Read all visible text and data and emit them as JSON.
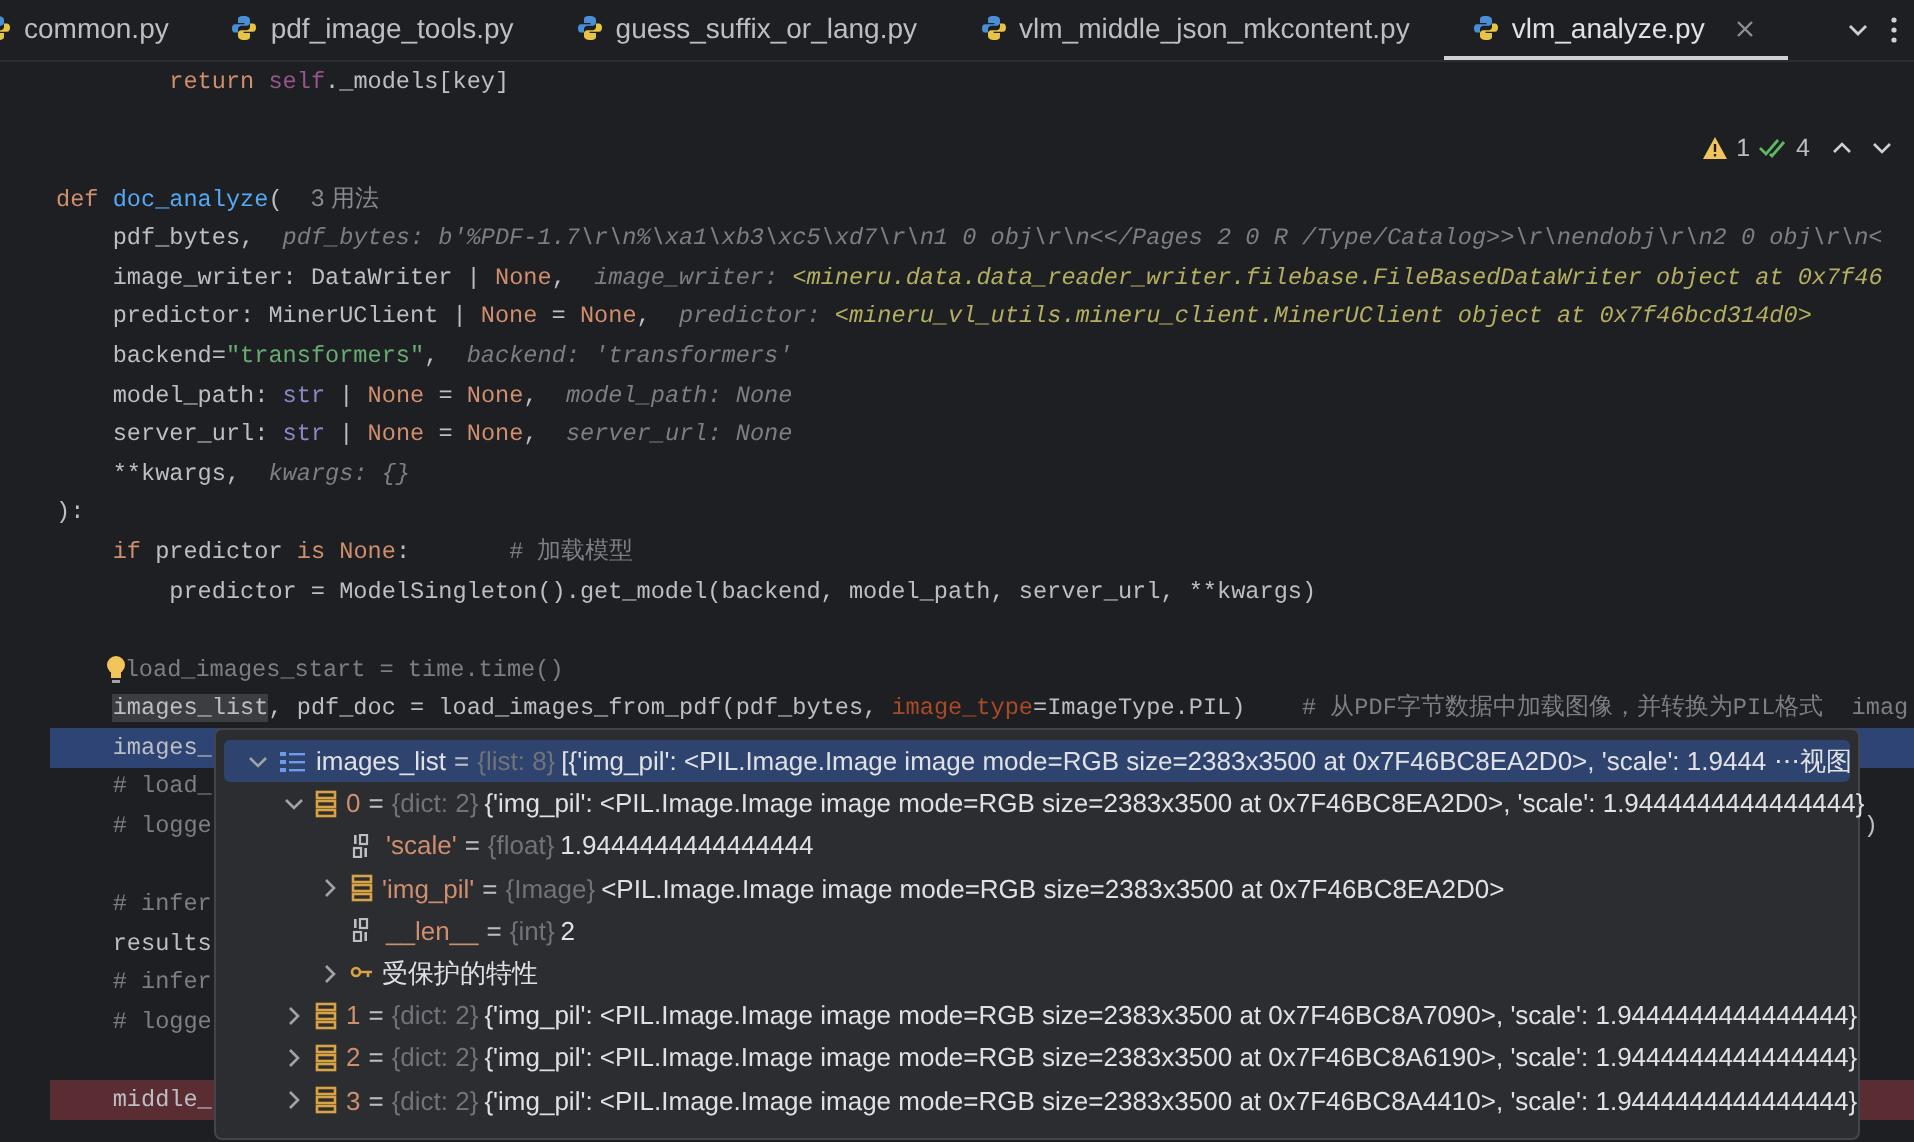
{
  "tabs": [
    {
      "label": "common.py",
      "selected": false
    },
    {
      "label": "pdf_image_tools.py",
      "selected": false
    },
    {
      "label": "guess_suffix_or_lang.py",
      "selected": false
    },
    {
      "label": "vlm_middle_json_mkcontent.py",
      "selected": false
    },
    {
      "label": "vlm_analyze.py",
      "selected": true
    }
  ],
  "inspections": {
    "warnings": "1",
    "passed": "4"
  },
  "lines": [
    {
      "tokens": [
        {
          "t": "        return ",
          "kind": "kw"
        },
        {
          "t": "self",
          "kind": "self"
        },
        {
          "t": "._models[key]",
          "kind": "plain"
        }
      ]
    },
    {
      "kind": "blank"
    },
    {
      "kind": "blank"
    },
    {
      "tokens": [
        {
          "t": "def ",
          "kind": "kw"
        },
        {
          "t": "doc_analyze",
          "kind": "fn"
        },
        {
          "t": "(  ",
          "kind": "plain"
        },
        {
          "t": "3 用法",
          "kind": "usage"
        }
      ]
    },
    {
      "tokens": [
        {
          "t": "    pdf_bytes,  ",
          "kind": "plain"
        },
        {
          "t": "pdf_bytes: b'%PDF-1.7\\r\\n%\\xa1\\xb3\\xc5\\xd7\\r\\n1 0 obj\\r\\n<</Pages 2 0 R /Type/Catalog>>\\r\\nendobj\\r\\n2 0 obj\\r\\n<",
          "kind": "hint"
        }
      ]
    },
    {
      "tokens": [
        {
          "t": "    image_writer: DataWriter | ",
          "kind": "plain"
        },
        {
          "t": "None",
          "kind": "kw"
        },
        {
          "t": ",  ",
          "kind": "plain"
        },
        {
          "t": "image_writer: ",
          "kind": "hint"
        },
        {
          "t": "<mineru.data.data_reader_writer.filebase.FileBasedDataWriter object at 0x7f46",
          "kind": "hintval"
        }
      ]
    },
    {
      "tokens": [
        {
          "t": "    predictor: MinerUClient | ",
          "kind": "plain"
        },
        {
          "t": "None",
          "kind": "kw"
        },
        {
          "t": " = ",
          "kind": "plain"
        },
        {
          "t": "None",
          "kind": "kw"
        },
        {
          "t": ",  ",
          "kind": "plain"
        },
        {
          "t": "predictor: ",
          "kind": "hint"
        },
        {
          "t": "<mineru_vl_utils.mineru_client.MinerUClient object at 0x7f46bcd314d0>",
          "kind": "hintval"
        }
      ]
    },
    {
      "tokens": [
        {
          "t": "    backend=",
          "kind": "plain"
        },
        {
          "t": "\"transformers\"",
          "kind": "str"
        },
        {
          "t": ",  ",
          "kind": "plain"
        },
        {
          "t": "backend: 'transformers'",
          "kind": "hint"
        }
      ]
    },
    {
      "tokens": [
        {
          "t": "    model_path: ",
          "kind": "plain"
        },
        {
          "t": "str",
          "kind": "builtin"
        },
        {
          "t": " | ",
          "kind": "plain"
        },
        {
          "t": "None",
          "kind": "kw"
        },
        {
          "t": " = ",
          "kind": "plain"
        },
        {
          "t": "None",
          "kind": "kw"
        },
        {
          "t": ",  ",
          "kind": "plain"
        },
        {
          "t": "model_path: None",
          "kind": "hint"
        }
      ]
    },
    {
      "tokens": [
        {
          "t": "    server_url: ",
          "kind": "plain"
        },
        {
          "t": "str",
          "kind": "builtin"
        },
        {
          "t": " | ",
          "kind": "plain"
        },
        {
          "t": "None",
          "kind": "kw"
        },
        {
          "t": " = ",
          "kind": "plain"
        },
        {
          "t": "None",
          "kind": "kw"
        },
        {
          "t": ",  ",
          "kind": "plain"
        },
        {
          "t": "server_url: None",
          "kind": "hint"
        }
      ]
    },
    {
      "tokens": [
        {
          "t": "    **kwargs,  ",
          "kind": "plain"
        },
        {
          "t": "kwargs: {}",
          "kind": "hint"
        }
      ]
    },
    {
      "tokens": [
        {
          "t": "):",
          "kind": "plain"
        }
      ]
    },
    {
      "tokens": [
        {
          "t": "    if ",
          "kind": "kw"
        },
        {
          "t": "predictor ",
          "kind": "plain"
        },
        {
          "t": "is None",
          "kind": "kw"
        },
        {
          "t": ":       ",
          "kind": "plain"
        },
        {
          "t": "# 加载模型",
          "kind": "comment"
        }
      ]
    },
    {
      "tokens": [
        {
          "t": "        predictor = ModelSingleton().get_model(backend, model_path, server_url, **kwargs)",
          "kind": "plain"
        }
      ]
    },
    {
      "kind": "blank"
    },
    {
      "bulb": true,
      "tokens": [
        {
          "t": "    load_images_start = time.time()",
          "kind": "comment"
        }
      ]
    },
    {
      "tokens": [
        {
          "t": "    images_list",
          "kind": "hl"
        },
        {
          "t": ", pdf_doc = load_images_from_pdf(pdf_bytes, ",
          "kind": "plain"
        },
        {
          "t": "image_type",
          "kind": "param"
        },
        {
          "t": "=ImageType.PIL)    ",
          "kind": "plain"
        },
        {
          "t": "# 从PDF字节数据中加载图像，并转换为PIL格式  imag",
          "kind": "comment"
        }
      ]
    },
    {
      "kind": "current",
      "tokens": [
        {
          "t": "    images_",
          "kind": "plain"
        }
      ]
    },
    {
      "tokens": [
        {
          "t": "    # load_",
          "kind": "comment"
        }
      ]
    },
    {
      "tokens": [
        {
          "t": "    # logge",
          "kind": "comment"
        }
      ],
      "tail": ")"
    },
    {
      "kind": "blank"
    },
    {
      "tokens": [
        {
          "t": "    # infer",
          "kind": "comment"
        }
      ]
    },
    {
      "tokens": [
        {
          "t": "    results",
          "kind": "plain"
        }
      ]
    },
    {
      "tokens": [
        {
          "t": "    # infer",
          "kind": "comment"
        }
      ]
    },
    {
      "tokens": [
        {
          "t": "    # logge",
          "kind": "comment"
        }
      ]
    },
    {
      "kind": "blank"
    },
    {
      "kind": "breakpoint",
      "tokens": [
        {
          "t": "    middle_",
          "kind": "plain"
        }
      ]
    }
  ],
  "debug_popup": {
    "view_link": "视图",
    "node": {
      "kind": "list",
      "name": "images_list",
      "eq": "=",
      "type": "{list: 8}",
      "value": "[{'img_pil': <PIL.Image.Image image mode=RGB size=2383x3500 at 0x7F46BC8EA2D0>, 'scale': 1.9444 ⋯",
      "expanded": true,
      "selected": true,
      "children": [
        {
          "kind": "dict",
          "name": "0",
          "eq": "=",
          "type": "{dict: 2}",
          "value": "{'img_pil': <PIL.Image.Image image mode=RGB size=2383x3500 at 0x7F46BC8EA2D0>, 'scale': 1.9444444444444444}",
          "expanded": true,
          "selected": false,
          "children": [
            {
              "kind": "number",
              "name": "'scale'",
              "eq": "=",
              "type": "{float}",
              "value": "1.9444444444444444",
              "selected": false
            },
            {
              "kind": "image",
              "name": "'img_pil'",
              "eq": "=",
              "type": "{Image}",
              "value": "<PIL.Image.Image image mode=RGB size=2383x3500 at 0x7F46BC8EA2D0>",
              "expanded": false,
              "selected": false
            },
            {
              "kind": "number",
              "name": "__len__",
              "eq": "=",
              "type": "{int}",
              "value": "2",
              "selected": false
            },
            {
              "kind": "protected",
              "name": "受保护的特性",
              "expanded": false,
              "selected": false
            }
          ]
        },
        {
          "kind": "dict",
          "name": "1",
          "eq": "=",
          "type": "{dict: 2}",
          "value": "{'img_pil': <PIL.Image.Image image mode=RGB size=2383x3500 at 0x7F46BC8A7090>, 'scale': 1.9444444444444444}",
          "expanded": false,
          "selected": false
        },
        {
          "kind": "dict",
          "name": "2",
          "eq": "=",
          "type": "{dict: 2}",
          "value": "{'img_pil': <PIL.Image.Image image mode=RGB size=2383x3500 at 0x7F46BC8A6190>, 'scale': 1.9444444444444444}",
          "expanded": false,
          "selected": false
        },
        {
          "kind": "dict",
          "name": "3",
          "eq": "=",
          "type": "{dict: 2}",
          "value": "{'img_pil': <PIL.Image.Image image mode=RGB size=2383x3500 at 0x7F46BC8A4410>, 'scale': 1.9444444444444444}",
          "expanded": false,
          "selected": false
        }
      ]
    }
  }
}
